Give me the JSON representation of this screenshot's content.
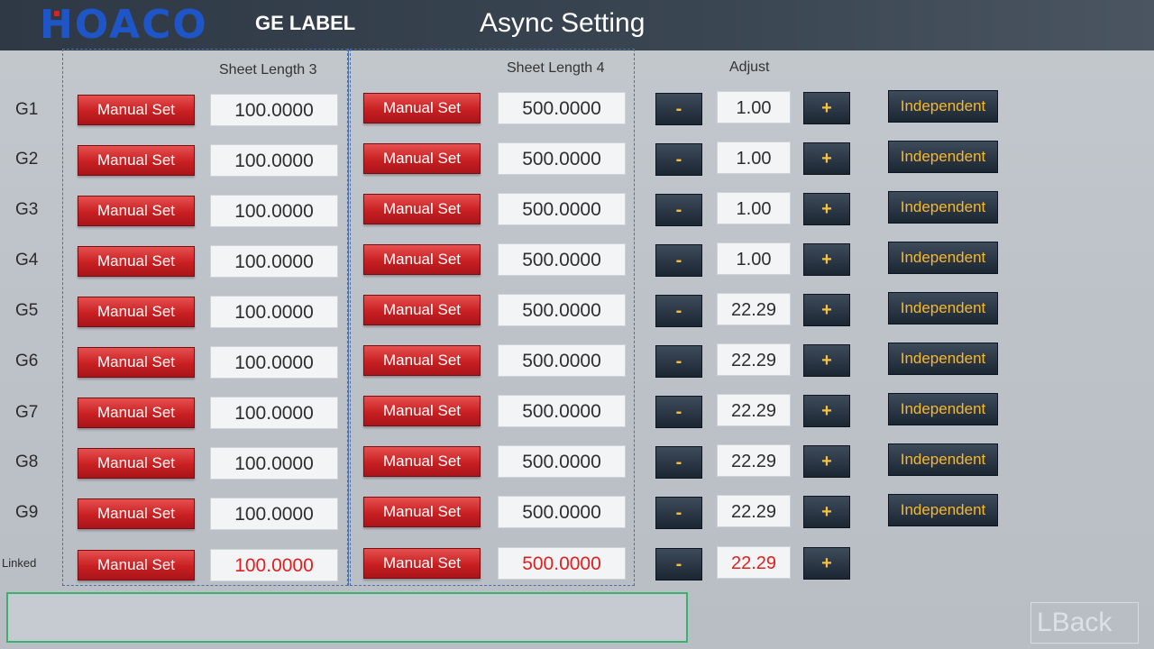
{
  "header": {
    "logo": "HOACO",
    "subtitle": "GE LABEL",
    "title": "Async Setting"
  },
  "columns": {
    "sheet3": "Sheet Length 3",
    "sheet4": "Sheet Length 4",
    "adjust": "Adjust"
  },
  "labels": {
    "manual_set": "Manual Set",
    "minus": "-",
    "plus": "+",
    "independent": "Independent"
  },
  "rows": [
    {
      "label": "G1",
      "sheet3": "100.0000",
      "sheet4": "500.0000",
      "adjust": "1.00",
      "independent": "Independent"
    },
    {
      "label": "G2",
      "sheet3": "100.0000",
      "sheet4": "500.0000",
      "adjust": "1.00",
      "independent": "Independent"
    },
    {
      "label": "G3",
      "sheet3": "100.0000",
      "sheet4": "500.0000",
      "adjust": "1.00",
      "independent": "Independent"
    },
    {
      "label": "G4",
      "sheet3": "100.0000",
      "sheet4": "500.0000",
      "adjust": "1.00",
      "independent": "Independent"
    },
    {
      "label": "G5",
      "sheet3": "100.0000",
      "sheet4": "500.0000",
      "adjust": "22.29",
      "independent": "Independent"
    },
    {
      "label": "G6",
      "sheet3": "100.0000",
      "sheet4": "500.0000",
      "adjust": "22.29",
      "independent": "Independent"
    },
    {
      "label": "G7",
      "sheet3": "100.0000",
      "sheet4": "500.0000",
      "adjust": "22.29",
      "independent": "Independent"
    },
    {
      "label": "G8",
      "sheet3": "100.0000",
      "sheet4": "500.0000",
      "adjust": "22.29",
      "independent": "Independent"
    },
    {
      "label": "G9",
      "sheet3": "100.0000",
      "sheet4": "500.0000",
      "adjust": "22.29",
      "independent": "Independent"
    },
    {
      "label": "Linked",
      "sheet3": "100.0000",
      "sheet4": "500.0000",
      "adjust": "22.29",
      "independent": ""
    }
  ],
  "footer": {
    "back_label": "LBack"
  },
  "colors": {
    "accent_red": "#c91f22",
    "linked_value": "#e02020",
    "dark_button": "#1c2633",
    "gold_text": "#f5b830"
  }
}
